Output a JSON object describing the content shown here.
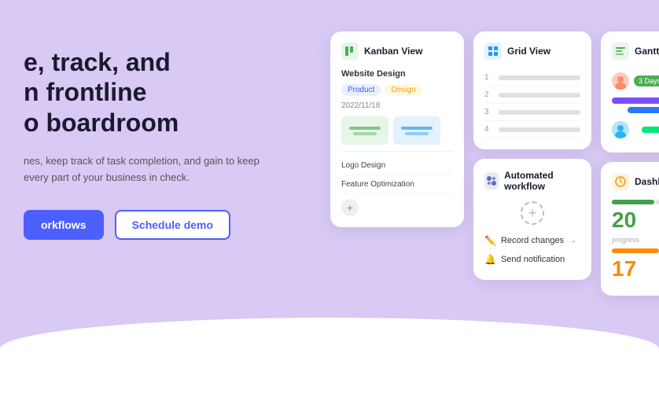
{
  "hero": {
    "title_line1": "e, track, and",
    "title_line2": "n frontline",
    "title_line3": "o boardroom",
    "subtitle": "nes, keep track of task completion, and gain\nto keep every part of your business in check.",
    "btn_primary": "orkflows",
    "btn_secondary": "Schedule demo"
  },
  "kanban": {
    "title": "Kanban View",
    "task1": "Website Design",
    "tag1": "Product",
    "tag2": "Design",
    "date": "2022/11/18",
    "task2": "Logo Design",
    "task3": "Feature Optimization",
    "plus": "+"
  },
  "grid": {
    "title": "Grid View",
    "rows": [
      "1",
      "2",
      "3",
      "4"
    ]
  },
  "gantt": {
    "title": "Gantt View",
    "badge": "3 Days"
  },
  "workflow": {
    "title": "Automated workflow",
    "plus": "+",
    "item1": "Record changes",
    "item2": "Send notification"
  },
  "dashboard": {
    "title": "Dashboard",
    "num1": "20",
    "num2": "17"
  }
}
